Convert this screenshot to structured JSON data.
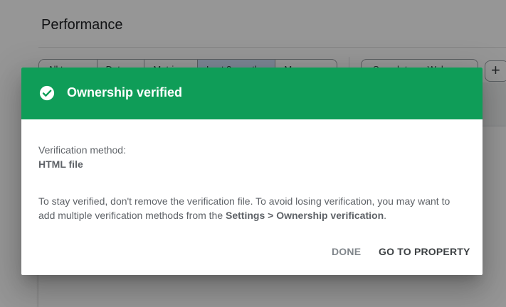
{
  "background": {
    "page_title": "Performance",
    "filter_chips": [
      "All types",
      "Date",
      "Metric",
      "Last 3 months",
      "More"
    ],
    "compare_label": "Search type: Web",
    "add_filter_label": "+"
  },
  "dialog": {
    "title": "Ownership verified",
    "method_label": "Verification method:",
    "method_value": "HTML file",
    "info_text_prefix": "To stay verified, don't remove the verification file. To avoid losing verification, you may want to add multiple verification methods from the ",
    "info_text_link": "Settings > Ownership verification",
    "info_text_suffix": ".",
    "buttons": {
      "done": "DONE",
      "go_to_property": "GO TO PROPERTY"
    }
  },
  "colors": {
    "header_green": "#0f9d58",
    "text_gray": "#5f6368",
    "done_gray": "#80868b"
  },
  "icons": {
    "header": "check-circle-icon"
  }
}
